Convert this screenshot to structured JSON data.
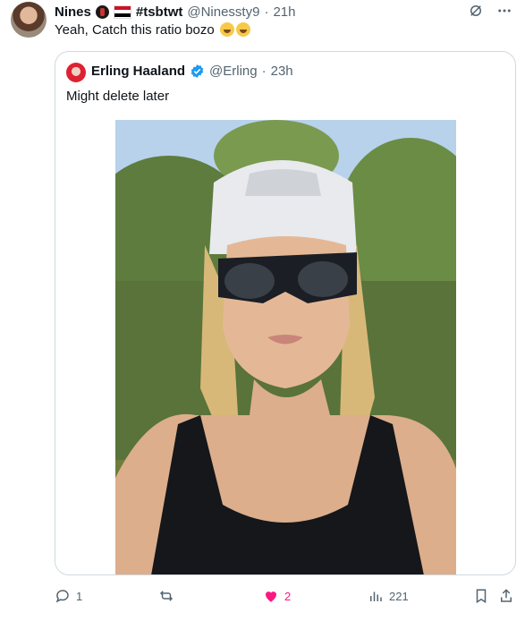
{
  "tweet": {
    "author_name": "Nines",
    "hashtag": "#tsbtwt",
    "handle": "@Ninessty9",
    "separator": "·",
    "time": "21h",
    "text": "Yeah, Catch this ratio bozo"
  },
  "quote": {
    "author_name": "Erling Haaland",
    "handle": "@Erling",
    "separator": "·",
    "time": "23h",
    "text": "Might delete later"
  },
  "actions": {
    "replies": "1",
    "retweets": "",
    "likes": "2",
    "views": "221"
  },
  "colors": {
    "like": "#f91880",
    "verified": "#1d9bf0",
    "muted": "#536471"
  }
}
